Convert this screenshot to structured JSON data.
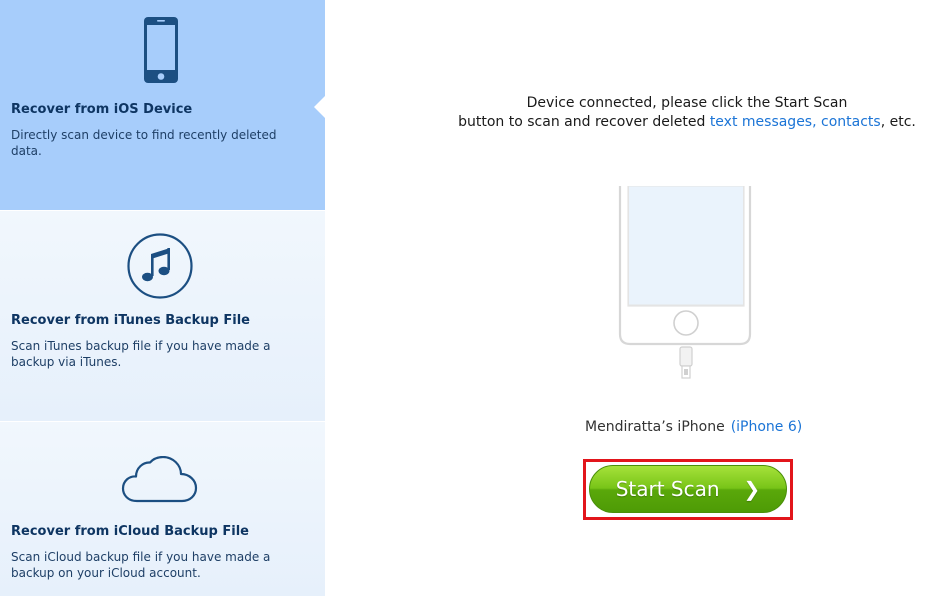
{
  "sidebar": {
    "options": [
      {
        "title": "Recover from iOS Device",
        "description": "Directly scan device to find recently deleted data.",
        "icon": "phone-icon",
        "selected": true
      },
      {
        "title": "Recover from iTunes Backup File",
        "description": "Scan iTunes backup file if you have made a backup via iTunes.",
        "icon": "music-note-icon",
        "selected": false
      },
      {
        "title": "Recover from iCloud Backup File",
        "description": "Scan iCloud backup file if you have made a backup on your iCloud account.",
        "icon": "cloud-icon",
        "selected": false
      }
    ]
  },
  "main": {
    "message_line1": "Device connected, please click the Start Scan",
    "message_line2_prefix": "button to scan and recover deleted ",
    "link_text_messages": "text messages,",
    "link_contacts": "contacts",
    "message_line2_suffix": ", etc.",
    "device_name": "Mendiratta’s iPhone",
    "device_model": "(iPhone 6)",
    "start_scan_label": "Start Scan",
    "start_scan_chevron": "❯"
  },
  "colors": {
    "selected_bg": "#a7cdfb",
    "link": "#1b74d6",
    "button_green": "#78c418",
    "highlight_red": "#e2151b",
    "icon_navy": "#1c4f82"
  }
}
